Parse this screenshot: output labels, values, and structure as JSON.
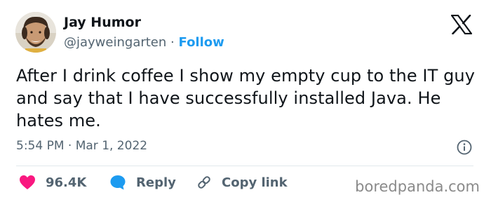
{
  "author": {
    "display_name": "Jay Humor",
    "handle": "@jayweingarten",
    "separator": "·",
    "follow_label": "Follow"
  },
  "tweet": {
    "text": "After I drink coffee I show my empty cup to the IT guy and say that I have successfully installed Java. He hates me.",
    "timestamp": "5:54 PM · Mar 1, 2022"
  },
  "actions": {
    "likes_count": "96.4K",
    "reply_label": "Reply",
    "copy_link_label": "Copy link"
  },
  "watermark": "boredpanda.com",
  "icons": {
    "platform": "x-logo-icon",
    "info": "info-icon",
    "like": "heart-icon",
    "reply": "reply-bubble-icon",
    "copy": "link-icon"
  },
  "colors": {
    "follow": "#1d9bf0",
    "heart": "#f91880",
    "reply_bubble": "#1d9bf0",
    "secondary_text": "#536471"
  }
}
